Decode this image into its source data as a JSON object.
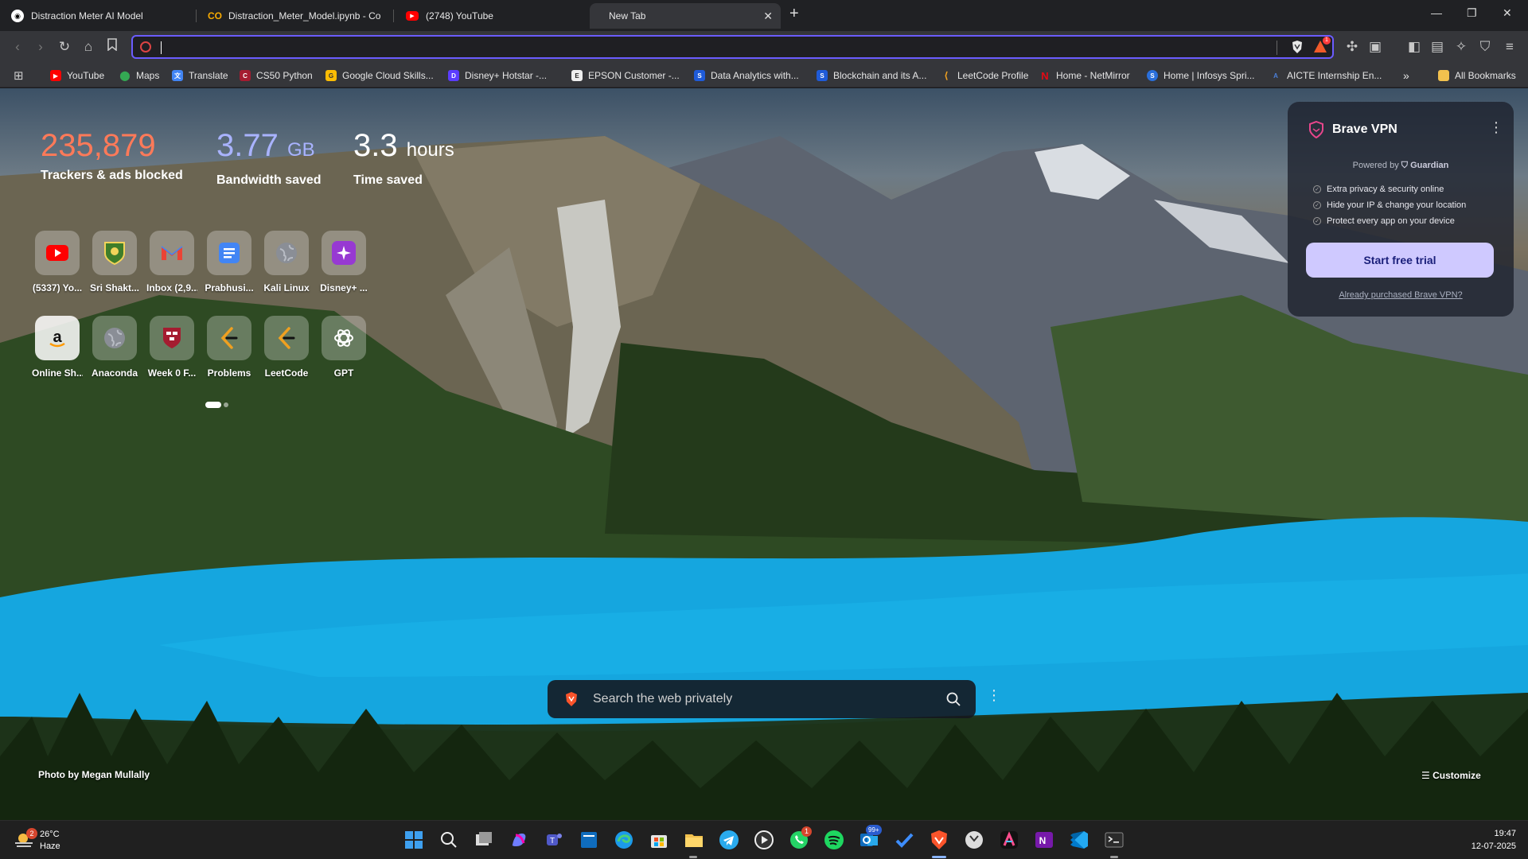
{
  "tabs": [
    {
      "title": "Distraction Meter AI Model",
      "icon": "github-icon"
    },
    {
      "title": "Distraction_Meter_Model.ipynb - Colab",
      "icon": "colab-icon"
    },
    {
      "title": "(2748) YouTube",
      "icon": "youtube-icon"
    },
    {
      "title": "New Tab",
      "icon": "none"
    }
  ],
  "omnibox": {
    "value": "",
    "placeholder": ""
  },
  "rewards_badge": "1",
  "bookmarks": [
    {
      "label": "YouTube",
      "color": "#ff0000",
      "glyph": "▶"
    },
    {
      "label": "Maps",
      "color": "#34a853",
      "glyph": "●"
    },
    {
      "label": "Translate",
      "color": "#4285f4",
      "glyph": "文"
    },
    {
      "label": "CS50 Python",
      "color": "#a51c30",
      "glyph": "C"
    },
    {
      "label": "Google Cloud Skills...",
      "color": "#fbbc04",
      "glyph": "G"
    },
    {
      "label": "Disney+ Hotstar -...",
      "color": "#5b3cff",
      "glyph": "D"
    },
    {
      "label": "EPSON Customer -...",
      "color": "#eeeeee",
      "glyph": "E"
    },
    {
      "label": "Data Analytics with...",
      "color": "#1f5bd8",
      "glyph": "S"
    },
    {
      "label": "Blockchain and its A...",
      "color": "#1f5bd8",
      "glyph": "S"
    },
    {
      "label": "LeetCode Profile",
      "color": "#f0a020",
      "glyph": "L"
    },
    {
      "label": "Home - NetMirror",
      "color": "#e50914",
      "glyph": "N"
    },
    {
      "label": "Home | Infosys Spri...",
      "color": "#2a6fdb",
      "glyph": "S"
    },
    {
      "label": "AICTE Internship En...",
      "color": "#4a7fd8",
      "glyph": "A"
    }
  ],
  "all_bookmarks_label": "All Bookmarks",
  "stats": {
    "trackers_value": "235,879",
    "trackers_label": "Trackers & ads blocked",
    "bandwidth_value": "3.77",
    "bandwidth_unit": "GB",
    "bandwidth_label": "Bandwidth saved",
    "time_value": "3.3",
    "time_unit": "hours",
    "time_label": "Time saved"
  },
  "top_sites": [
    {
      "label": "(5337) Yo...",
      "icon": "youtube-icon"
    },
    {
      "label": "Sri Shakt...",
      "icon": "crest-icon"
    },
    {
      "label": "Inbox (2,9...",
      "icon": "gmail-icon"
    },
    {
      "label": "Prabhusi...",
      "icon": "docs-icon"
    },
    {
      "label": "Kali Linux",
      "icon": "globe-icon"
    },
    {
      "label": "Disney+ ...",
      "icon": "hotstar-icon"
    },
    {
      "label": "Online Sh...",
      "icon": "amazon-icon"
    },
    {
      "label": "Anaconda",
      "icon": "globe-icon"
    },
    {
      "label": "Week 0 F...",
      "icon": "harvard-icon"
    },
    {
      "label": "Problems",
      "icon": "leetcode-icon"
    },
    {
      "label": "LeetCode",
      "icon": "leetcode-icon"
    },
    {
      "label": "GPT",
      "icon": "openai-icon"
    }
  ],
  "vpn": {
    "title": "Brave VPN",
    "powered_by": "Powered by",
    "partner": "Guardian",
    "features": [
      "Extra privacy & security online",
      "Hide your IP & change your location",
      "Protect every app on your device"
    ],
    "cta": "Start free trial",
    "secondary": "Already purchased Brave VPN?"
  },
  "search": {
    "placeholder": "Search the web privately"
  },
  "photo_credit": "Photo by Megan Mullally",
  "customize_label": "Customize",
  "taskbar": {
    "weather_temp": "26°C",
    "weather_cond": "Haze",
    "weather_badge": "2",
    "whatsapp_badge": "1",
    "mail_badge": "99+",
    "time": "19:47",
    "date": "12-07-2025"
  }
}
